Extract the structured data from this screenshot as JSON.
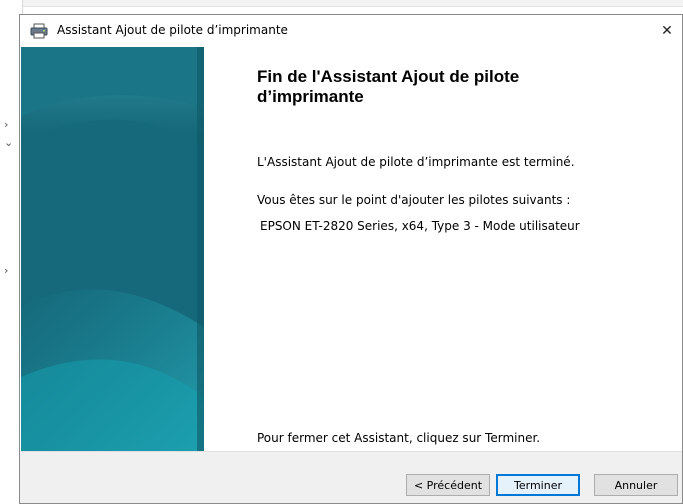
{
  "window": {
    "title": "Assistant Ajout de pilote d’imprimante",
    "close_glyph": "✕"
  },
  "main": {
    "heading": "Fin de l'Assistant Ajout de pilote d’imprimante",
    "completed_text": "L'Assistant Ajout de pilote d’imprimante est terminé.",
    "about_to_add_text": "Vous êtes sur le point d'ajouter les pilotes suivants :",
    "driver_entry": "EPSON ET-2820 Series, x64, Type 3 - Mode utilisateur",
    "close_instruction": "Pour fermer cet Assistant, cliquez sur Terminer."
  },
  "buttons": {
    "previous": "< Précédent",
    "finish": "Terminer",
    "cancel": "Annuler"
  },
  "background": {
    "chevron_right": "›",
    "chevron_down": "⌄"
  },
  "colors": {
    "panel_top": "#176f80",
    "panel_bottom": "#13a3b3",
    "default_button_border": "#0078d7"
  }
}
